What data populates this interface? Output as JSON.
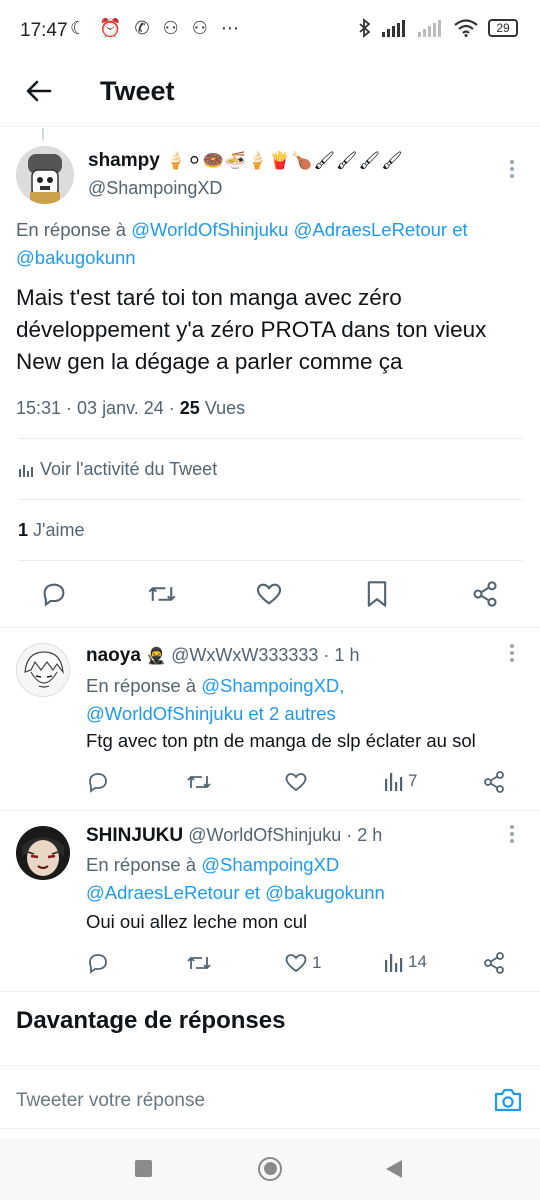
{
  "status_bar": {
    "time": "17:47",
    "left_icons": "☾ ⏰ ✆ ⚇ ⚇ ⋯",
    "battery": "29"
  },
  "header": {
    "title": "Tweet"
  },
  "main_tweet": {
    "name": "shampy",
    "name_emojis": "🍦⚪🍩🍜🍦🍟🍗🖌🖌🖌🖌",
    "handle": "@ShampoingXD",
    "reply_prefix": "En réponse à",
    "reply_to": "@WorldOfShinjuku @AdraesLeRetour",
    "reply_and": "et",
    "reply_to_2": "@bakugokunn",
    "text": "Mais t'est taré toi ton manga avec zéro développement y'a zéro PROTA dans ton vieux New gen la dégage a parler comme ça",
    "time": "15:31 · 03 janv. 24 · ",
    "views_count": "25",
    "views_label": " Vues",
    "activity": "Voir l'activité du Tweet",
    "likes_count": "1",
    "likes_label": " J'aime"
  },
  "replies": [
    {
      "name": "naoya",
      "emoji": "🥷",
      "handle_time": "@WxWxW333333 · 1 h",
      "reply_prefix": "En réponse à",
      "reply_line1_link": "@ShampoingXD,",
      "reply_line2_link": "@WorldOfShinjuku et 2 autres",
      "text": "Ftg avec ton ptn de manga de slp éclater au sol",
      "likes": "",
      "views": "7"
    },
    {
      "name": "SHINJUKU",
      "handle_time": "@WorldOfShinjuku · 2 h",
      "reply_prefix": "En réponse à",
      "reply_line1_link": "@ShampoingXD",
      "reply_line2_link": "@AdraesLeRetour et @bakugokunn",
      "text": "Oui oui allez leche mon cul",
      "likes": "1",
      "views": "14"
    }
  ],
  "more_replies": {
    "title": "Davantage de réponses"
  },
  "composer": {
    "placeholder": "Tweeter votre réponse"
  },
  "colors": {
    "accent": "#1d9bf0",
    "muted": "#536471",
    "text": "#0f1419"
  }
}
